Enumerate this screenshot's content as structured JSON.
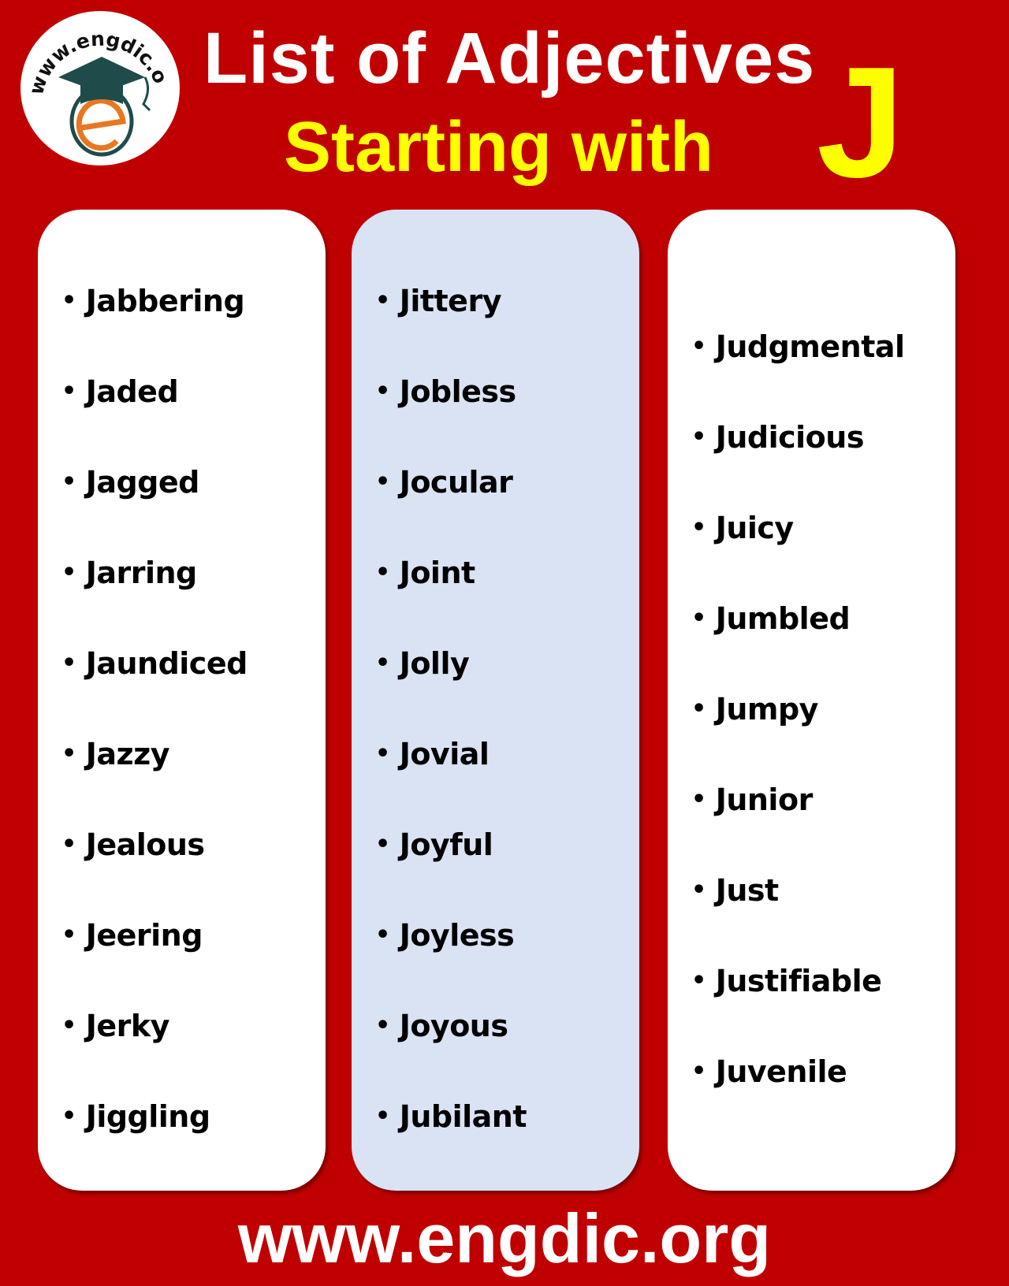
{
  "logo": {
    "text": "www.engdic.org",
    "letter": "e"
  },
  "header": {
    "line1": "List of Adjectives",
    "line2": "Starting with",
    "letter": "J"
  },
  "colors": {
    "background": "#c00000",
    "accent": "#ffff00",
    "card_white": "#ffffff",
    "card_blue": "#dae3f3"
  },
  "bullet": "•",
  "columns": [
    {
      "items": [
        "Jabbering",
        "Jaded",
        "Jagged",
        "Jarring",
        "Jaundiced",
        "Jazzy",
        "Jealous",
        "Jeering",
        "Jerky",
        "Jiggling"
      ]
    },
    {
      "items": [
        "Jittery",
        "Jobless",
        "Jocular",
        "Joint",
        "Jolly",
        "Jovial",
        "Joyful",
        "Joyless",
        "Joyous",
        "Jubilant"
      ]
    },
    {
      "items": [
        "Judgmental",
        "Judicious",
        "Juicy",
        "Jumbled",
        "Jumpy",
        "Junior",
        "Just",
        "Justifiable",
        "Juvenile"
      ]
    }
  ],
  "footer": {
    "text": "www.engdic.org"
  }
}
